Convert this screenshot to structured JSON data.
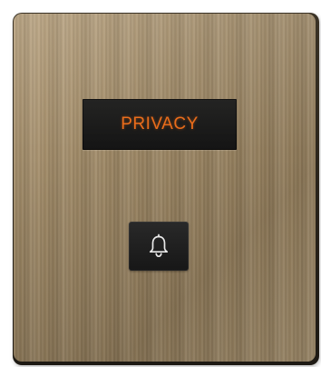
{
  "display": {
    "label": "PRIVACY",
    "text_color": "#ea6a17"
  },
  "doorbell_button": {
    "icon": "bell-icon"
  },
  "plate": {
    "finish_color": "#a08a69"
  }
}
